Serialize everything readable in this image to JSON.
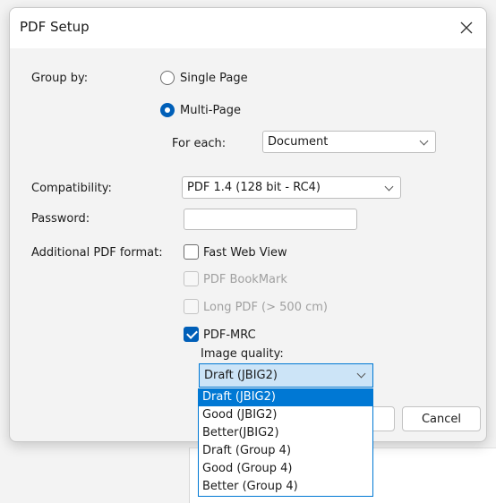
{
  "dialog": {
    "title": "PDF Setup",
    "close_icon": "close-icon"
  },
  "group_by": {
    "label": "Group by:",
    "options": [
      {
        "label": "Single Page",
        "checked": false
      },
      {
        "label": "Multi-Page",
        "checked": true
      }
    ],
    "for_each_label": "For each:",
    "for_each_value": "Document"
  },
  "compatibility": {
    "label": "Compatibility:",
    "value": "PDF 1.4 (128 bit - RC4)"
  },
  "password": {
    "label": "Password:",
    "value": ""
  },
  "additional": {
    "label": "Additional PDF format:",
    "options": [
      {
        "label": "Fast Web View",
        "checked": false,
        "enabled": true
      },
      {
        "label": "PDF BookMark",
        "checked": false,
        "enabled": false
      },
      {
        "label": "Long PDF (> 500 cm)",
        "checked": false,
        "enabled": false
      },
      {
        "label": "PDF-MRC",
        "checked": true,
        "enabled": true
      }
    ]
  },
  "image_quality": {
    "label": "Image quality:",
    "value": "Draft (JBIG2)",
    "options": [
      "Draft (JBIG2)",
      "Good (JBIG2)",
      "Better(JBIG2)",
      "Draft (Group 4)",
      "Good (Group 4)",
      "Better (Group 4)"
    ],
    "selected_index": 0
  },
  "buttons": {
    "cancel": "Cancel"
  },
  "colors": {
    "accent": "#005fb8",
    "selection": "#0078d4",
    "combo_highlight": "#cce4f7"
  }
}
